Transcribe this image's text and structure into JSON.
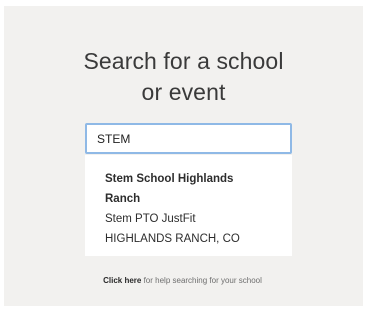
{
  "heading": {
    "line1": "Search for a school",
    "line2": "or event"
  },
  "search": {
    "value": "STEM"
  },
  "results": [
    {
      "name": "Stem School Highlands Ranch",
      "event": "Stem PTO JustFit",
      "location": "HIGHLANDS RANCH, CO"
    }
  ],
  "help": {
    "link_label": "Click here",
    "rest_text": " for help searching for your school"
  },
  "colors": {
    "panel_background": "#f2f1ef",
    "input_border": "#8fb9e6"
  }
}
